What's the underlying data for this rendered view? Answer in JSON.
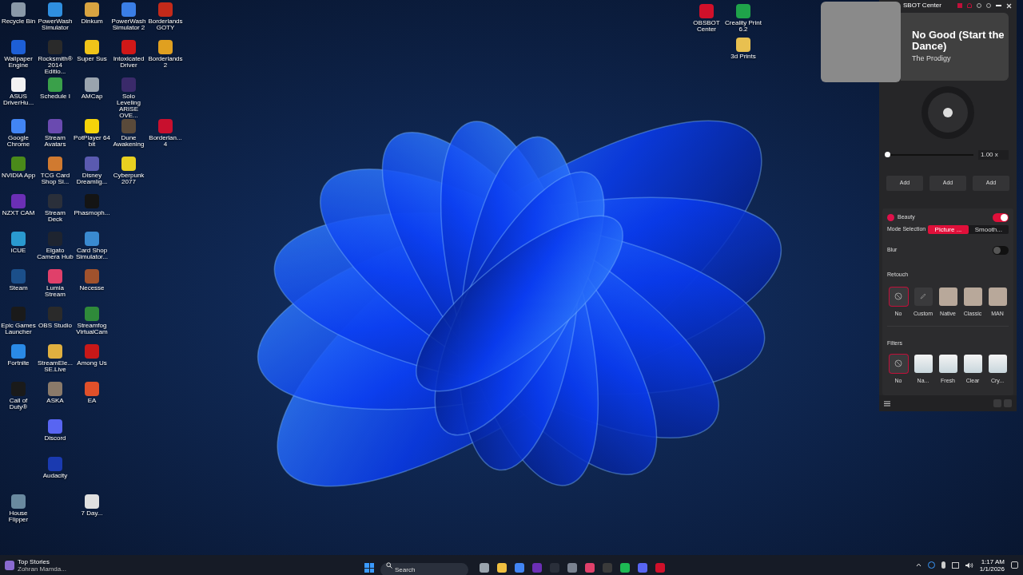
{
  "desktop_icons": [
    [
      {
        "kind": "shortcut",
        "label": "Recycle Bin",
        "color": "#8a99a8"
      },
      {
        "kind": "shortcut",
        "label": "PowerWash Simulator",
        "color": "#2f8fe0"
      },
      {
        "kind": "shortcut",
        "label": "Dinkum",
        "color": "#d9a441"
      },
      {
        "kind": "shortcut",
        "label": "PowerWash Simulator 2",
        "color": "#3a7ee6"
      },
      {
        "kind": "shortcut",
        "label": "Borderlands GOTY",
        "color": "#c42a1a"
      }
    ],
    [
      {
        "kind": "shortcut",
        "label": "Wallpaper Engine",
        "color": "#1d5fd6"
      },
      {
        "kind": "shortcut",
        "label": "Rocksmith® 2014 Editio...",
        "color": "#2a2a2a"
      },
      {
        "kind": "shortcut",
        "label": "Super Sus",
        "color": "#f0c419"
      },
      {
        "kind": "shortcut",
        "label": "Intoxicated Driver",
        "color": "#d01818"
      },
      {
        "kind": "shortcut",
        "label": "Borderlands 2",
        "color": "#e0a020"
      }
    ],
    [
      {
        "kind": "shortcut",
        "label": "ASUS DriverHu...",
        "color": "#f2f2f2"
      },
      {
        "kind": "shortcut",
        "label": "Schedule I",
        "color": "#3aa04a"
      },
      {
        "kind": "shortcut",
        "label": "AMCap",
        "color": "#9aa4ae"
      },
      {
        "kind": "shortcut",
        "label": "Solo Leveling ARISE OVE...",
        "color": "#3a2a6a"
      }
    ],
    [
      {
        "kind": "shortcut",
        "label": "Google Chrome",
        "color": "#4285f4"
      },
      {
        "kind": "shortcut",
        "label": "Stream Avatars",
        "color": "#6a4ab0"
      },
      {
        "kind": "shortcut",
        "label": "PotPlayer 64 bit",
        "color": "#f5d40a"
      },
      {
        "kind": "shortcut",
        "label": "Dune Awakening",
        "color": "#5a4a3a"
      },
      {
        "kind": "shortcut",
        "label": "Borderlan... 4",
        "color": "#c8102e"
      }
    ],
    [
      {
        "kind": "shortcut",
        "label": "NVIDIA App",
        "color": "#4a8a1a"
      },
      {
        "kind": "shortcut",
        "label": "TCG Card Shop Si...",
        "color": "#d07a30"
      },
      {
        "kind": "shortcut",
        "label": "Disney Dreamlig...",
        "color": "#5a5ab0"
      },
      {
        "kind": "shortcut",
        "label": "Cyberpunk 2077",
        "color": "#e8d020"
      }
    ],
    [
      {
        "kind": "shortcut",
        "label": "NZXT CAM",
        "color": "#6b2fb5"
      },
      {
        "kind": "shortcut",
        "label": "Stream Deck",
        "color": "#2a2f3a"
      },
      {
        "kind": "shortcut",
        "label": "Phasmoph...",
        "color": "#141414"
      }
    ],
    [
      {
        "kind": "shortcut",
        "label": "iCUE",
        "color": "#2a9ad0"
      },
      {
        "kind": "shortcut",
        "label": "Elgato Camera Hub",
        "color": "#1e2430"
      },
      {
        "kind": "shortcut",
        "label": "Card Shop Simulator...",
        "color": "#3a8ad0"
      }
    ],
    [
      {
        "kind": "shortcut",
        "label": "Steam",
        "color": "#1b4f8a"
      },
      {
        "kind": "shortcut",
        "label": "Lumia Stream",
        "color": "#e0406a"
      },
      {
        "kind": "shortcut",
        "label": "Necesse",
        "color": "#a0522d"
      }
    ],
    [
      {
        "kind": "shortcut",
        "label": "Epic Games Launcher",
        "color": "#1a1a1a"
      },
      {
        "kind": "shortcut",
        "label": "OBS Studio",
        "color": "#2a2a2a"
      },
      {
        "kind": "shortcut",
        "label": "Streamfog VirtualCam",
        "color": "#2f8a3a"
      }
    ],
    [
      {
        "kind": "shortcut",
        "label": "Fortnite",
        "color": "#2a8ae6"
      },
      {
        "kind": "shortcut",
        "label": "StreamEle... SE.Live",
        "color": "#e0b040"
      },
      {
        "kind": "shortcut",
        "label": "Among Us",
        "color": "#c81818"
      }
    ],
    [
      {
        "kind": "shortcut",
        "label": "Call of Duty®",
        "color": "#1a1a1a"
      },
      {
        "kind": "shortcut",
        "label": "ASKA",
        "color": "#8a7a6a"
      },
      {
        "kind": "shortcut",
        "label": "EA",
        "color": "#e0502a"
      }
    ],
    [
      {
        "kind": "blank"
      },
      {
        "kind": "shortcut",
        "label": "Discord",
        "color": "#5865f2"
      }
    ],
    [
      {
        "kind": "blank"
      },
      {
        "kind": "shortcut",
        "label": "Audacity",
        "color": "#1a3ab0"
      }
    ],
    [
      {
        "kind": "shortcut",
        "label": "House Flipper",
        "color": "#6a8aa0"
      },
      {
        "kind": "blank"
      },
      {
        "kind": "shortcut",
        "label": "7 Day...",
        "color": "#e0e0e0"
      }
    ]
  ],
  "pinned_icons": [
    [
      {
        "kind": "shortcut",
        "label": "OBSBOT Center",
        "color": "#d0102a"
      }
    ],
    [
      {
        "kind": "shortcut",
        "label": "Creality Print 6.2",
        "color": "#1fa34a"
      },
      {
        "kind": "shortcut",
        "label": "3d Prints",
        "color": "#e8c050"
      }
    ]
  ],
  "obsbot": {
    "title": "SBOT Center",
    "now_playing": {
      "title": "No Good (Start the Dance)",
      "artist": "The Prodigy"
    },
    "speed": {
      "level": 0,
      "reading": "1.00 x"
    },
    "add_buttons": [
      "Add",
      "Add",
      "Add"
    ],
    "beauty": {
      "label": "Beauty",
      "on": true
    },
    "mode_selection": {
      "label": "Mode Selection",
      "options": [
        {
          "label": "Picture ...",
          "selected": true
        },
        {
          "label": "Smooth...",
          "selected": false
        }
      ]
    },
    "blur": {
      "label": "Blur",
      "on": false
    },
    "retouch": {
      "label": "Retouch",
      "items": [
        {
          "label": "No",
          "kind": "none",
          "selected": true
        },
        {
          "label": "Custom",
          "kind": "custom",
          "selected": false
        },
        {
          "label": "Native",
          "kind": "photo",
          "selected": false
        },
        {
          "label": "Classic",
          "kind": "photo",
          "selected": false
        },
        {
          "label": "MAN",
          "kind": "photo",
          "selected": false
        }
      ]
    },
    "filters": {
      "label": "Filters",
      "items": [
        {
          "label": "No",
          "kind": "none",
          "selected": true
        },
        {
          "label": "Na...",
          "kind": "preset",
          "selected": false
        },
        {
          "label": "Fresh",
          "kind": "preset",
          "selected": false
        },
        {
          "label": "Clear",
          "kind": "preset",
          "selected": false
        },
        {
          "label": "Cry...",
          "kind": "preset",
          "selected": false
        }
      ]
    }
  },
  "taskbar": {
    "widget": {
      "title": "Top Stories",
      "subtitle": "Zohran Mamda..."
    },
    "search": {
      "placeholder": "Search"
    },
    "apps": [
      {
        "color": "#9aa4ae"
      },
      {
        "color": "#f0c040"
      },
      {
        "color": "#4285f4"
      },
      {
        "color": "#6b2fb5"
      },
      {
        "color": "#2a2f3a"
      },
      {
        "color": "#7a8290"
      },
      {
        "color": "#e0406a"
      },
      {
        "color": "#3a3a3a"
      },
      {
        "color": "#1db954"
      },
      {
        "color": "#5865f2"
      },
      {
        "color": "#d0102a"
      }
    ],
    "tray": {
      "time": "1:17 AM",
      "date": "1/1/2026"
    }
  }
}
